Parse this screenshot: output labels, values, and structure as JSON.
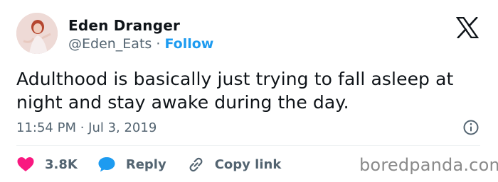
{
  "author": {
    "name": "Eden Dranger",
    "handle": "@Eden_Eats",
    "separator": "·",
    "follow_label": "Follow"
  },
  "tweet": {
    "text_line1": "Adulthood is basically just trying to fall asleep at",
    "text_line2": "night and stay awake during the day.",
    "timestamp": "11:54 PM · Jul 3, 2019"
  },
  "actions": {
    "like_count": "3.8K",
    "reply_label": "Reply",
    "copy_link_label": "Copy link"
  },
  "icons": {
    "logo": "x-logo-icon",
    "info": "info-icon",
    "like": "heart-icon",
    "reply": "speech-bubble-icon",
    "copy": "link-icon"
  },
  "watermark": "boredpanda.com",
  "colors": {
    "accent": "#1d9bf0",
    "like": "#f91880",
    "muted": "#536471",
    "text": "#0f1419"
  }
}
